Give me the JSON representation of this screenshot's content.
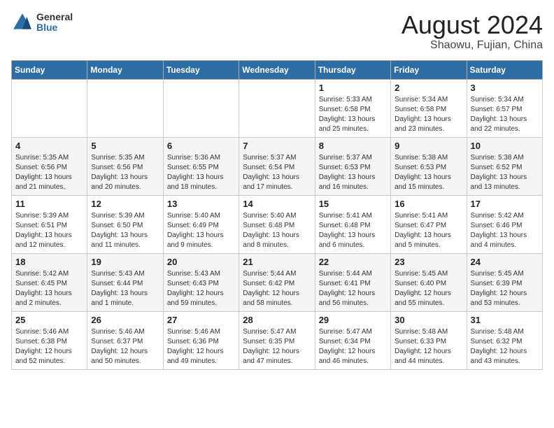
{
  "logo": {
    "general": "General",
    "blue": "Blue"
  },
  "title": "August 2024",
  "subtitle": "Shaowu, Fujian, China",
  "days_of_week": [
    "Sunday",
    "Monday",
    "Tuesday",
    "Wednesday",
    "Thursday",
    "Friday",
    "Saturday"
  ],
  "weeks": [
    [
      {
        "day": "",
        "info": ""
      },
      {
        "day": "",
        "info": ""
      },
      {
        "day": "",
        "info": ""
      },
      {
        "day": "",
        "info": ""
      },
      {
        "day": "1",
        "info": "Sunrise: 5:33 AM\nSunset: 6:58 PM\nDaylight: 13 hours and 25 minutes."
      },
      {
        "day": "2",
        "info": "Sunrise: 5:34 AM\nSunset: 6:58 PM\nDaylight: 13 hours and 23 minutes."
      },
      {
        "day": "3",
        "info": "Sunrise: 5:34 AM\nSunset: 6:57 PM\nDaylight: 13 hours and 22 minutes."
      }
    ],
    [
      {
        "day": "4",
        "info": "Sunrise: 5:35 AM\nSunset: 6:56 PM\nDaylight: 13 hours and 21 minutes."
      },
      {
        "day": "5",
        "info": "Sunrise: 5:35 AM\nSunset: 6:56 PM\nDaylight: 13 hours and 20 minutes."
      },
      {
        "day": "6",
        "info": "Sunrise: 5:36 AM\nSunset: 6:55 PM\nDaylight: 13 hours and 18 minutes."
      },
      {
        "day": "7",
        "info": "Sunrise: 5:37 AM\nSunset: 6:54 PM\nDaylight: 13 hours and 17 minutes."
      },
      {
        "day": "8",
        "info": "Sunrise: 5:37 AM\nSunset: 6:53 PM\nDaylight: 13 hours and 16 minutes."
      },
      {
        "day": "9",
        "info": "Sunrise: 5:38 AM\nSunset: 6:53 PM\nDaylight: 13 hours and 15 minutes."
      },
      {
        "day": "10",
        "info": "Sunrise: 5:38 AM\nSunset: 6:52 PM\nDaylight: 13 hours and 13 minutes."
      }
    ],
    [
      {
        "day": "11",
        "info": "Sunrise: 5:39 AM\nSunset: 6:51 PM\nDaylight: 13 hours and 12 minutes."
      },
      {
        "day": "12",
        "info": "Sunrise: 5:39 AM\nSunset: 6:50 PM\nDaylight: 13 hours and 11 minutes."
      },
      {
        "day": "13",
        "info": "Sunrise: 5:40 AM\nSunset: 6:49 PM\nDaylight: 13 hours and 9 minutes."
      },
      {
        "day": "14",
        "info": "Sunrise: 5:40 AM\nSunset: 6:48 PM\nDaylight: 13 hours and 8 minutes."
      },
      {
        "day": "15",
        "info": "Sunrise: 5:41 AM\nSunset: 6:48 PM\nDaylight: 13 hours and 6 minutes."
      },
      {
        "day": "16",
        "info": "Sunrise: 5:41 AM\nSunset: 6:47 PM\nDaylight: 13 hours and 5 minutes."
      },
      {
        "day": "17",
        "info": "Sunrise: 5:42 AM\nSunset: 6:46 PM\nDaylight: 13 hours and 4 minutes."
      }
    ],
    [
      {
        "day": "18",
        "info": "Sunrise: 5:42 AM\nSunset: 6:45 PM\nDaylight: 13 hours and 2 minutes."
      },
      {
        "day": "19",
        "info": "Sunrise: 5:43 AM\nSunset: 6:44 PM\nDaylight: 13 hours and 1 minute."
      },
      {
        "day": "20",
        "info": "Sunrise: 5:43 AM\nSunset: 6:43 PM\nDaylight: 12 hours and 59 minutes."
      },
      {
        "day": "21",
        "info": "Sunrise: 5:44 AM\nSunset: 6:42 PM\nDaylight: 12 hours and 58 minutes."
      },
      {
        "day": "22",
        "info": "Sunrise: 5:44 AM\nSunset: 6:41 PM\nDaylight: 12 hours and 56 minutes."
      },
      {
        "day": "23",
        "info": "Sunrise: 5:45 AM\nSunset: 6:40 PM\nDaylight: 12 hours and 55 minutes."
      },
      {
        "day": "24",
        "info": "Sunrise: 5:45 AM\nSunset: 6:39 PM\nDaylight: 12 hours and 53 minutes."
      }
    ],
    [
      {
        "day": "25",
        "info": "Sunrise: 5:46 AM\nSunset: 6:38 PM\nDaylight: 12 hours and 52 minutes."
      },
      {
        "day": "26",
        "info": "Sunrise: 5:46 AM\nSunset: 6:37 PM\nDaylight: 12 hours and 50 minutes."
      },
      {
        "day": "27",
        "info": "Sunrise: 5:46 AM\nSunset: 6:36 PM\nDaylight: 12 hours and 49 minutes."
      },
      {
        "day": "28",
        "info": "Sunrise: 5:47 AM\nSunset: 6:35 PM\nDaylight: 12 hours and 47 minutes."
      },
      {
        "day": "29",
        "info": "Sunrise: 5:47 AM\nSunset: 6:34 PM\nDaylight: 12 hours and 46 minutes."
      },
      {
        "day": "30",
        "info": "Sunrise: 5:48 AM\nSunset: 6:33 PM\nDaylight: 12 hours and 44 minutes."
      },
      {
        "day": "31",
        "info": "Sunrise: 5:48 AM\nSunset: 6:32 PM\nDaylight: 12 hours and 43 minutes."
      }
    ]
  ]
}
